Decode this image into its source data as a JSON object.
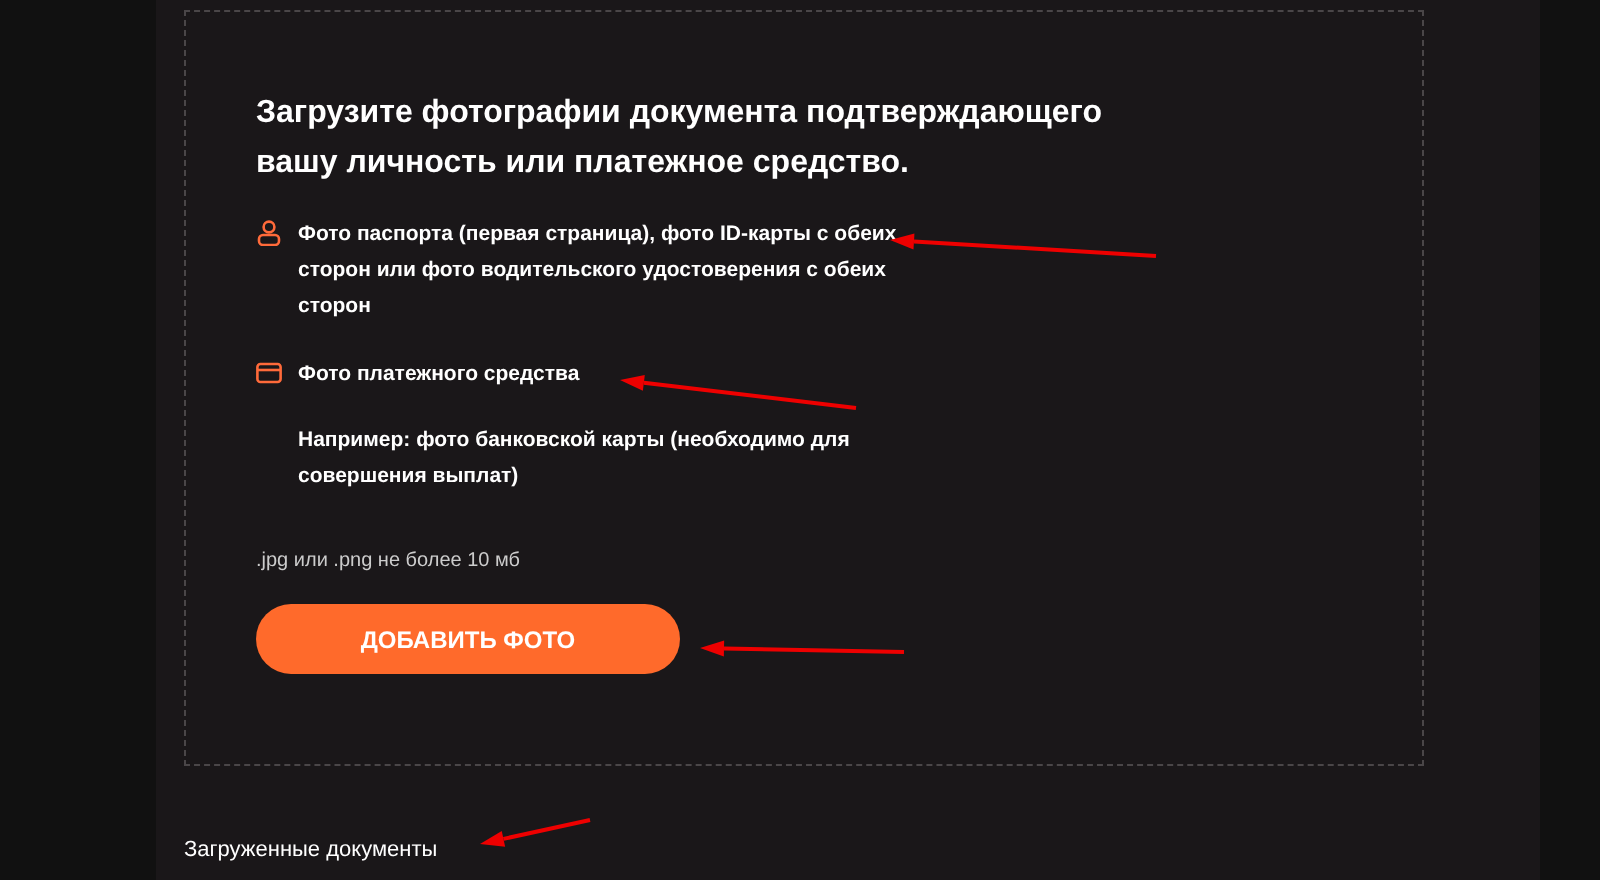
{
  "upload_panel": {
    "title": "Загрузите фотографии документа подтверждающего вашу личность или платежное средство.",
    "items": [
      {
        "kind": "person",
        "text": "Фото паспорта (первая страница), фото ID-карты с обеих сторон или фото водительского удостоверения с обеих сторон"
      },
      {
        "kind": "card",
        "text": "Фото платежного средства",
        "note": "Например: фото банковской карты (необходимо для совершения выплат)"
      }
    ],
    "hint": ".jpg или .png не более 10 мб",
    "button": "ДОБАВИТЬ ФОТО"
  },
  "uploaded_heading": "Загруженные документы"
}
